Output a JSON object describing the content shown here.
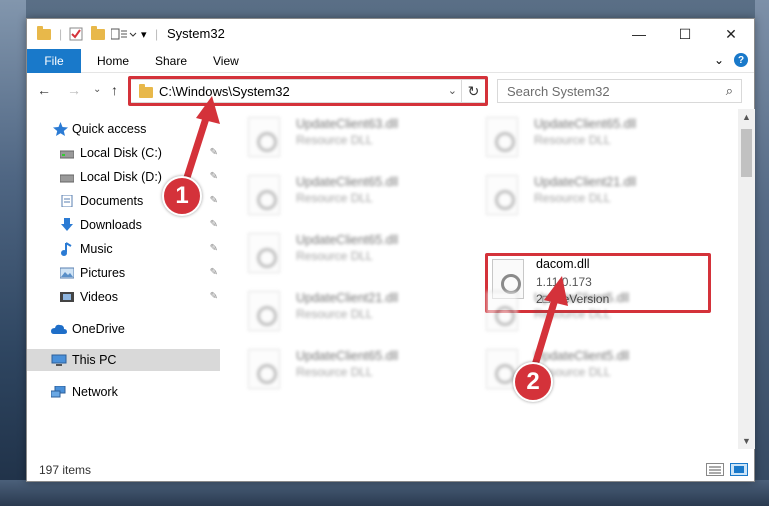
{
  "window": {
    "title": "System32",
    "minimize_glyph": "—",
    "maximize_glyph": "☐",
    "close_glyph": "✕"
  },
  "ribbon": {
    "tabs": [
      "File",
      "Home",
      "Share",
      "View"
    ],
    "expand_glyph": "⌄",
    "help_glyph": "?"
  },
  "nav": {
    "back_glyph": "←",
    "forward_glyph": "→",
    "recent_glyph": "⌄",
    "up_glyph": "↑",
    "address_path": "C:\\Windows\\System32",
    "address_dropdown_glyph": "⌄",
    "refresh_glyph": "↻",
    "search_placeholder": "Search System32",
    "search_glyph": "⌕"
  },
  "sidebar": {
    "items": [
      {
        "label": "Quick access",
        "icon": "star-icon"
      },
      {
        "label": "Local Disk (C:)",
        "icon": "drive-icon"
      },
      {
        "label": "Local Disk (D:)",
        "icon": "drive-icon"
      },
      {
        "label": "Documents",
        "icon": "documents-icon"
      },
      {
        "label": "Downloads",
        "icon": "download-icon"
      },
      {
        "label": "Music",
        "icon": "music-icon"
      },
      {
        "label": "Pictures",
        "icon": "pictures-icon"
      },
      {
        "label": "Videos",
        "icon": "videos-icon"
      },
      {
        "label": "OneDrive",
        "icon": "cloud-icon"
      },
      {
        "label": "This PC",
        "icon": "computer-icon"
      },
      {
        "label": "Network",
        "icon": "network-icon"
      }
    ],
    "pin_glyph": "📌"
  },
  "files": [
    {
      "name": "UpdateClient63.dll",
      "sub": "Resource DLL"
    },
    {
      "name": "UpdateClient65.dll",
      "sub": "Resource DLL"
    },
    {
      "name": "UpdateClient65.dll",
      "sub": "Resource DLL"
    },
    {
      "name": "UpdateClient21.dll",
      "sub": "Resource DLL"
    },
    {
      "name": "UpdateClient65.dll",
      "sub": "Resource DLL"
    },
    {
      "name": "dacom.dll",
      "version": "1.11.0.173",
      "sub": "2□FileVersion"
    },
    {
      "name": "UpdateClient21.dll",
      "sub": "Resource DLL"
    },
    {
      "name": "UpdateClient5.dll",
      "sub": "Resource DLL"
    },
    {
      "name": "UpdateClient65.dll",
      "sub": "Resource DLL"
    },
    {
      "name": "UpdateClient5.dll",
      "sub": "Resource DLL"
    }
  ],
  "status": {
    "item_count": "197 items"
  },
  "callouts": [
    "1",
    "2"
  ],
  "colors": {
    "accent": "#1979ca",
    "highlight": "#d4323a"
  }
}
